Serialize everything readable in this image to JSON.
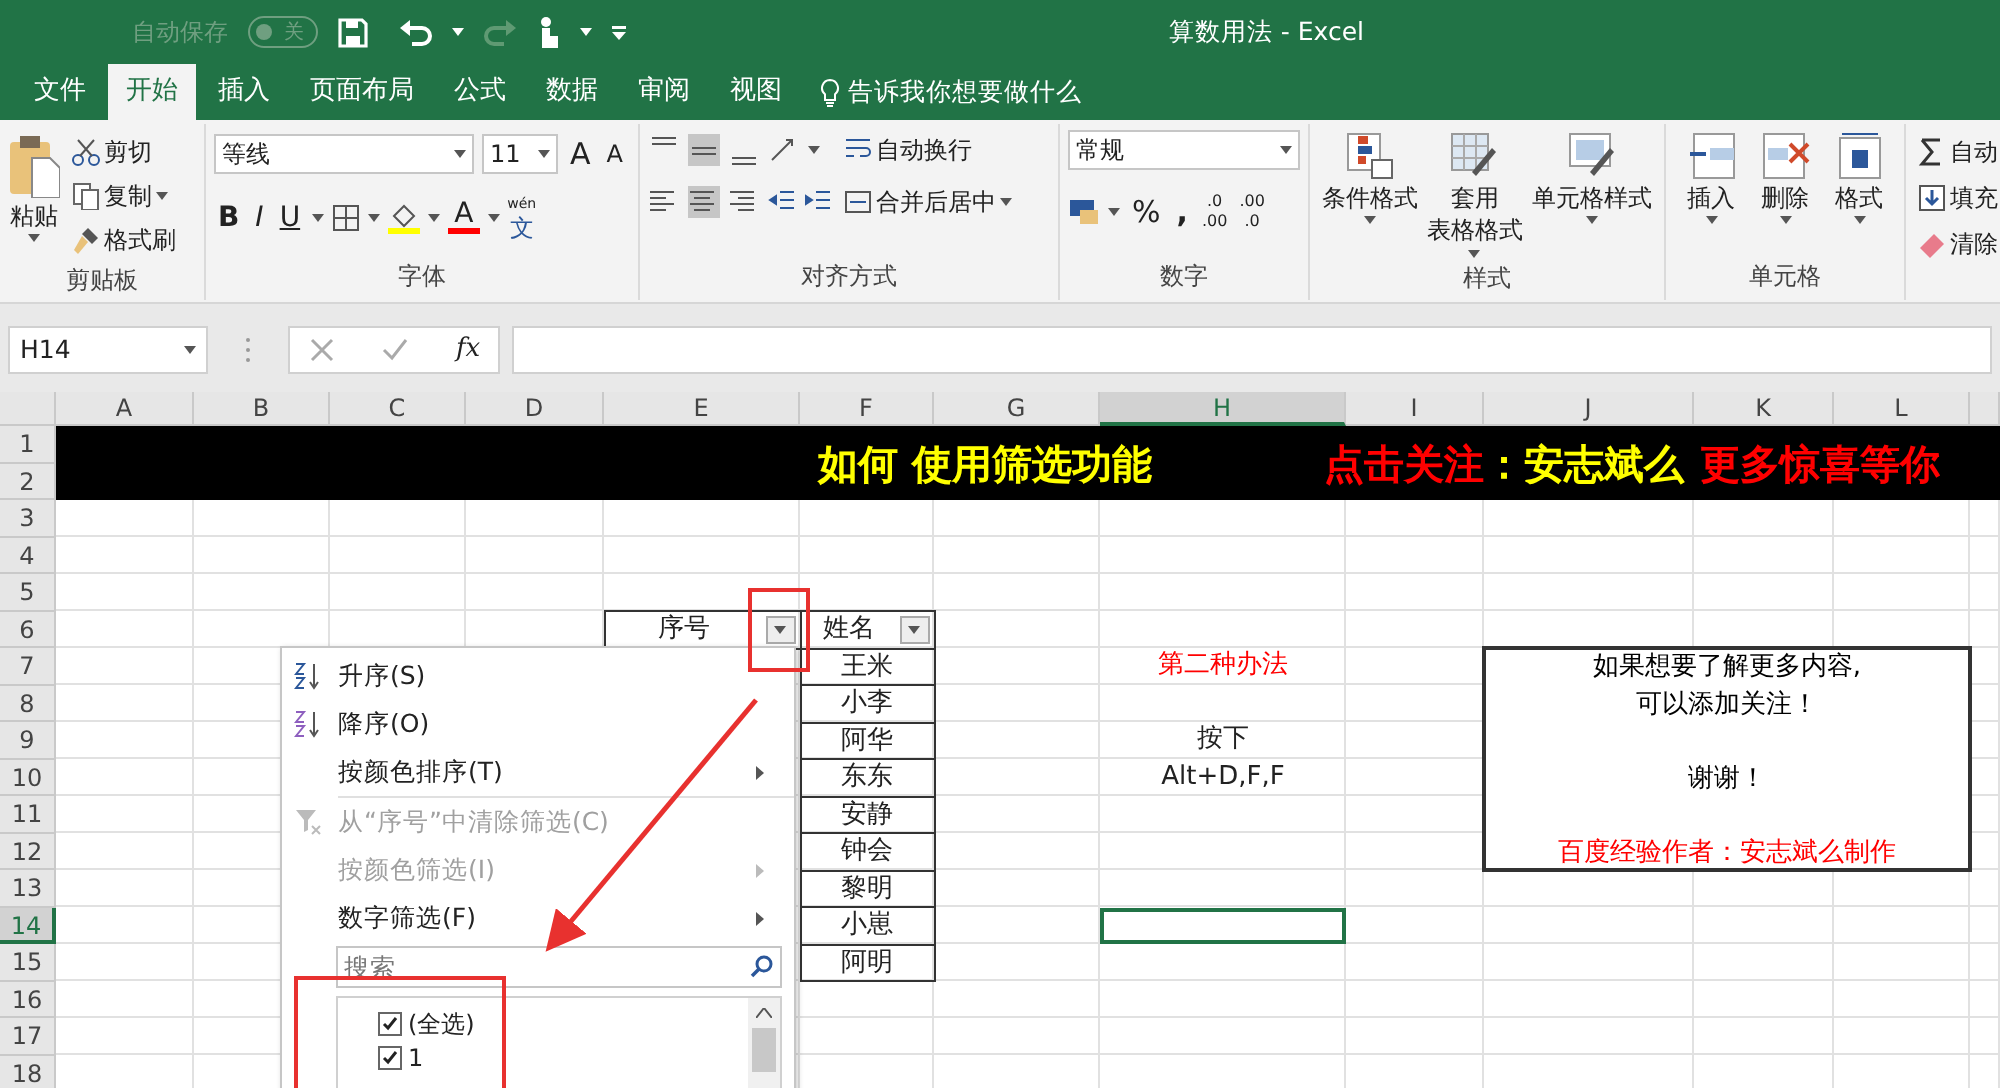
{
  "title_bar": {
    "autosave_label": "自动保存",
    "autosave_state": "关",
    "autosave_on": false,
    "title": "算数用法 - Excel"
  },
  "tabs": [
    {
      "label": "文件",
      "selected": false
    },
    {
      "label": "开始",
      "selected": true
    },
    {
      "label": "插入",
      "selected": false
    },
    {
      "label": "页面布局",
      "selected": false
    },
    {
      "label": "公式",
      "selected": false
    },
    {
      "label": "数据",
      "selected": false
    },
    {
      "label": "审阅",
      "selected": false
    },
    {
      "label": "视图",
      "selected": false
    }
  ],
  "tell_me": "告诉我你想要做什么",
  "clipboard": {
    "paste": "粘贴",
    "cut": "剪切",
    "copy": "复制",
    "format_painter": "格式刷",
    "label": "剪贴板"
  },
  "font": {
    "name": "等线",
    "size": "11",
    "grow": "A",
    "shrink": "A",
    "bold": "B",
    "italic": "I",
    "underline": "U",
    "font_color": "A",
    "phonetic_top": "wén",
    "phonetic": "文",
    "label": "字体"
  },
  "alignment": {
    "vertical": [
      {
        "selected": false
      },
      {
        "selected": true
      },
      {
        "selected": false
      }
    ],
    "horizontal": [
      {
        "selected": false
      },
      {
        "selected": true
      },
      {
        "selected": false
      }
    ],
    "wrap_text": "自动换行",
    "merge_center": "合并后居中",
    "label": "对齐方式"
  },
  "number": {
    "format": "常规",
    "percent": "%",
    "comma": ",",
    "increase_decimal": [
      ".0",
      ".00"
    ],
    "decrease_decimal": [
      ".00",
      ".0"
    ],
    "label": "数字"
  },
  "styles": {
    "buttons": [
      {
        "lines": [
          "条件格式"
        ],
        "kind": "conditional"
      },
      {
        "lines": [
          "套用",
          "表格格式"
        ],
        "kind": "table"
      },
      {
        "lines": [
          "单元格样式"
        ],
        "kind": "cell"
      }
    ],
    "label": "样式"
  },
  "cells": {
    "buttons": [
      {
        "label": "插入",
        "kind": "insert"
      },
      {
        "label": "删除",
        "kind": "delete"
      },
      {
        "label": "格式",
        "kind": "format"
      }
    ],
    "label": "单元格"
  },
  "editing": {
    "buttons": [
      {
        "label": "自动",
        "kind": "sum"
      },
      {
        "label": "填充",
        "kind": "fill"
      },
      {
        "label": "清除",
        "kind": "clear"
      }
    ]
  },
  "formula_bar": {
    "name_box": "H14",
    "fx": "fx"
  },
  "sheet": {
    "columns": [
      {
        "label": "A",
        "selected": false
      },
      {
        "label": "B",
        "selected": false
      },
      {
        "label": "C",
        "selected": false
      },
      {
        "label": "D",
        "selected": false
      },
      {
        "label": "E",
        "selected": false
      },
      {
        "label": "F",
        "selected": false
      },
      {
        "label": "G",
        "selected": false
      },
      {
        "label": "H",
        "selected": true
      },
      {
        "label": "I",
        "selected": false
      },
      {
        "label": "J",
        "selected": false
      },
      {
        "label": "K",
        "selected": false
      },
      {
        "label": "L",
        "selected": false
      }
    ],
    "rows": [
      {
        "label": "1",
        "selected": false
      },
      {
        "label": "2",
        "selected": false
      },
      {
        "label": "3",
        "selected": false
      },
      {
        "label": "4",
        "selected": false
      },
      {
        "label": "5",
        "selected": false
      },
      {
        "label": "6",
        "selected": false
      },
      {
        "label": "7",
        "selected": false
      },
      {
        "label": "8",
        "selected": false
      },
      {
        "label": "9",
        "selected": false
      },
      {
        "label": "10",
        "selected": false
      },
      {
        "label": "11",
        "selected": false
      },
      {
        "label": "12",
        "selected": false
      },
      {
        "label": "13",
        "selected": false
      },
      {
        "label": "14",
        "selected": true
      },
      {
        "label": "15",
        "selected": false
      },
      {
        "label": "16",
        "selected": false
      },
      {
        "label": "17",
        "selected": false
      },
      {
        "label": "18",
        "selected": false
      }
    ],
    "banner": [
      {
        "text": "如何 使用筛选功能",
        "color": "#ffff00"
      },
      {
        "text": "点击关注",
        "color": "#ff0000"
      },
      {
        "text": "：安志斌么",
        "color": "#ffff00"
      },
      {
        "text": "更多惊喜等你",
        "color": "#ff0000"
      }
    ],
    "list_headers": [
      {
        "text": "序号",
        "filter": true
      },
      {
        "text": "姓名",
        "filter": true
      }
    ],
    "names": [
      "王米",
      "小李",
      "阿华",
      "东东",
      "安静",
      "钟会",
      "黎明",
      "小崽",
      "阿明"
    ],
    "method": {
      "title": "第二种办法",
      "lines": [
        "按下",
        "Alt+D,F,F"
      ]
    },
    "note_box": {
      "lines": [
        {
          "text": "如果想要了解更多内容,",
          "color": "#000000",
          "space_before": false
        },
        {
          "text": "可以添加关注！",
          "color": "#000000",
          "space_before": false
        },
        {
          "text": "谢谢！",
          "color": "#000000",
          "space_before": true
        },
        {
          "text": "百度经验作者：安志斌么制作",
          "color": "#ff0000",
          "space_before": true
        }
      ]
    }
  },
  "filter_menu": {
    "items": [
      {
        "label": "升序(S)",
        "kind": "sort-asc",
        "disabled": false,
        "submenu": false,
        "separator_before": false
      },
      {
        "label": "降序(O)",
        "kind": "sort-desc",
        "disabled": false,
        "submenu": false,
        "separator_before": false
      },
      {
        "label": "按颜色排序(T)",
        "kind": "plain",
        "disabled": false,
        "submenu": true,
        "separator_before": false
      },
      {
        "label": "从“序号”中清除筛选(C)",
        "kind": "clear",
        "disabled": true,
        "submenu": false,
        "separator_before": true
      },
      {
        "label": "按颜色筛选(I)",
        "kind": "plain",
        "disabled": true,
        "submenu": true,
        "separator_before": false
      },
      {
        "label": "数字筛选(F)",
        "kind": "plain",
        "disabled": false,
        "submenu": true,
        "separator_before": false
      }
    ],
    "search_placeholder": "搜索",
    "values": [
      {
        "label": "(全选)",
        "checked": true
      },
      {
        "label": "1",
        "checked": true
      }
    ]
  }
}
